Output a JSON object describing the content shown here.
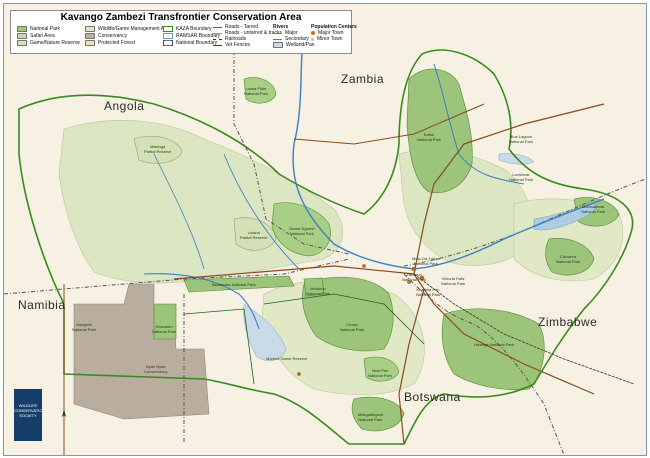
{
  "title": "Kavango Zambezi Transfrontier Conservation Area",
  "legend": {
    "col1": [
      "National Park",
      "Safari Area",
      "Game/Nature Reserve"
    ],
    "col2": [
      "Wildlife/Game Management Area",
      "Conservancy",
      "Protected Forest"
    ],
    "col3": [
      "KAZA Boundary",
      "RAMSAR Boundary",
      "National Boundary"
    ],
    "col4": [
      "Roads - Tarred",
      "Roads - untarred & tracks",
      "Railroads",
      "Vet Fences"
    ],
    "rivers_heading": "Rivers",
    "rivers": [
      "Major",
      "Secondary",
      "Wetland/Pan"
    ],
    "population_heading": "Population Centers",
    "population": [
      "Major Town",
      "Minor Town"
    ]
  },
  "countries": {
    "angola": "Angola",
    "zambia": "Zambia",
    "namibia": "Namibia",
    "zimbabwe": "Zimbabwe",
    "botswana": "Botswana"
  },
  "parks": {
    "lower_plain": "Luiana\nPartial Reserve",
    "mavinga": "Mavinga\nPartial Reserve",
    "kafue": "Kafue\nNational Park",
    "sioma": "Sioma Ngwezi\nNational Park",
    "hwange": "Hwange National Park",
    "chobe": "Chobe\nNational Park",
    "chizarira": "Chizarira\nNational Park",
    "matusadona": "Matusadona\nNational Park",
    "khaudum": "Khaudum\nNational Park",
    "mangetti": "Mangetti\nNational Park",
    "moremi": "Moremi Game Reserve",
    "nxai_pan": "Nxai Pan\nNational Park",
    "makgadikgadi": "Makgadikgadi\nNational Park",
    "bwabwata": "Bwabwata National Park",
    "liuwa": "Liuwa Plain\nNational Park",
    "mudumu": "Mudumu\nNational Park",
    "zambezi": "Zambezi\nNational Park",
    "kazuma": "Kazuma Pan\nNational Park",
    "vic_falls": "Victoria Falls\nNational Park",
    "mosi": "Mosi-Oa-Tunya\nNational Park",
    "nyae": "Nyae Nyae\nConservancy",
    "blue_lagoon": "Blue Lagoon\nNational Park",
    "lochinvar": "Lochinvar\nNational Park"
  },
  "logo": [
    "WILDLIFE",
    "CONSERVATION",
    "SOCIETY"
  ]
}
